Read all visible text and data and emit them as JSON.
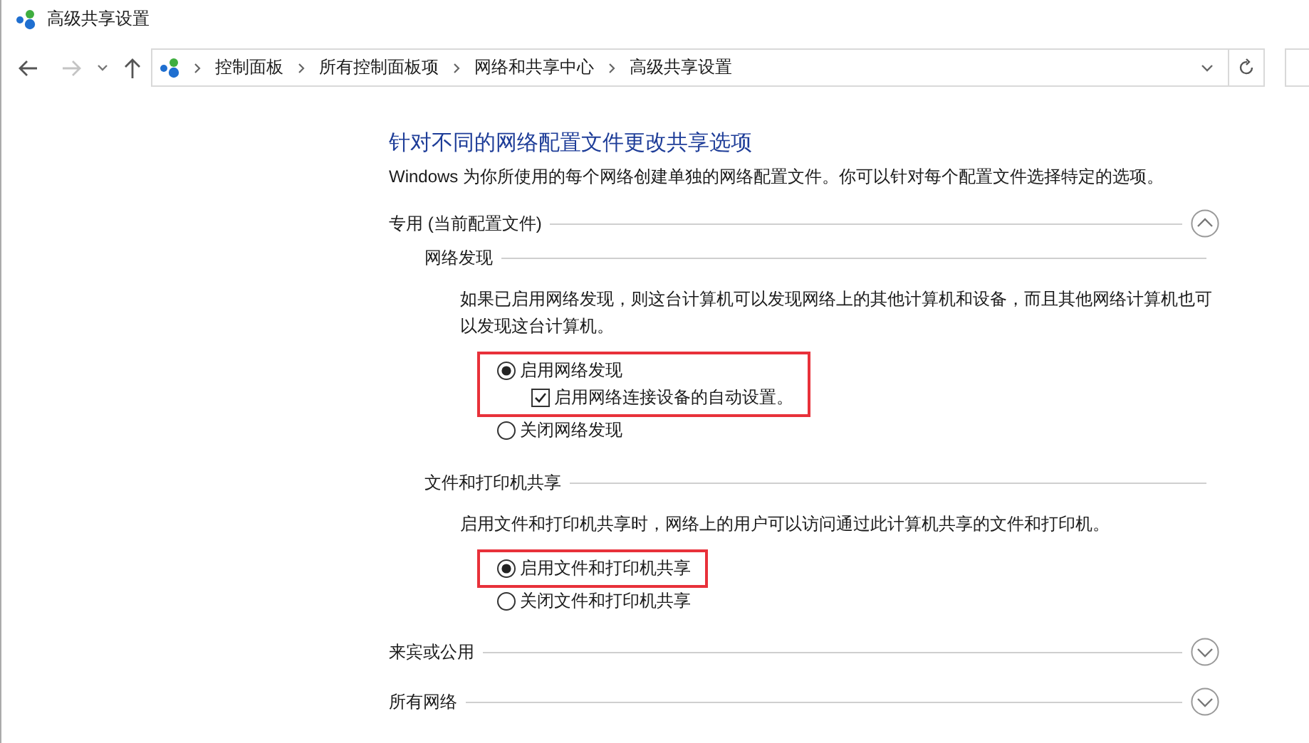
{
  "window": {
    "title": "高级共享设置"
  },
  "nav": {
    "back_disabled": false,
    "forward_disabled": true
  },
  "breadcrumb": [
    "控制面板",
    "所有控制面板项",
    "网络和共享中心",
    "高级共享设置"
  ],
  "heading": "针对不同的网络配置文件更改共享选项",
  "intro": "Windows 为你所使用的每个网络创建单独的网络配置文件。你可以针对每个配置文件选择特定的选项。",
  "sections": [
    {
      "title": "专用 (当前配置文件)",
      "expanded": true,
      "groups": [
        {
          "title": "网络发现",
          "description": "如果已启用网络发现，则这台计算机可以发现网络上的其他计算机和设备，而且其他网络计算机也可以发现这台计算机。",
          "options": [
            {
              "label": "启用网络发现",
              "selected": true,
              "highlighted": true,
              "children": [
                {
                  "label": "启用网络连接设备的自动设置。",
                  "checked": true
                }
              ]
            },
            {
              "label": "关闭网络发现",
              "selected": false,
              "highlighted": false
            }
          ]
        },
        {
          "title": "文件和打印机共享",
          "description": "启用文件和打印机共享时，网络上的用户可以访问通过此计算机共享的文件和打印机。",
          "options": [
            {
              "label": "启用文件和打印机共享",
              "selected": true,
              "highlighted": true
            },
            {
              "label": "关闭文件和打印机共享",
              "selected": false,
              "highlighted": false
            }
          ]
        }
      ]
    },
    {
      "title": "来宾或公用",
      "expanded": false
    },
    {
      "title": "所有网络",
      "expanded": false
    }
  ]
}
